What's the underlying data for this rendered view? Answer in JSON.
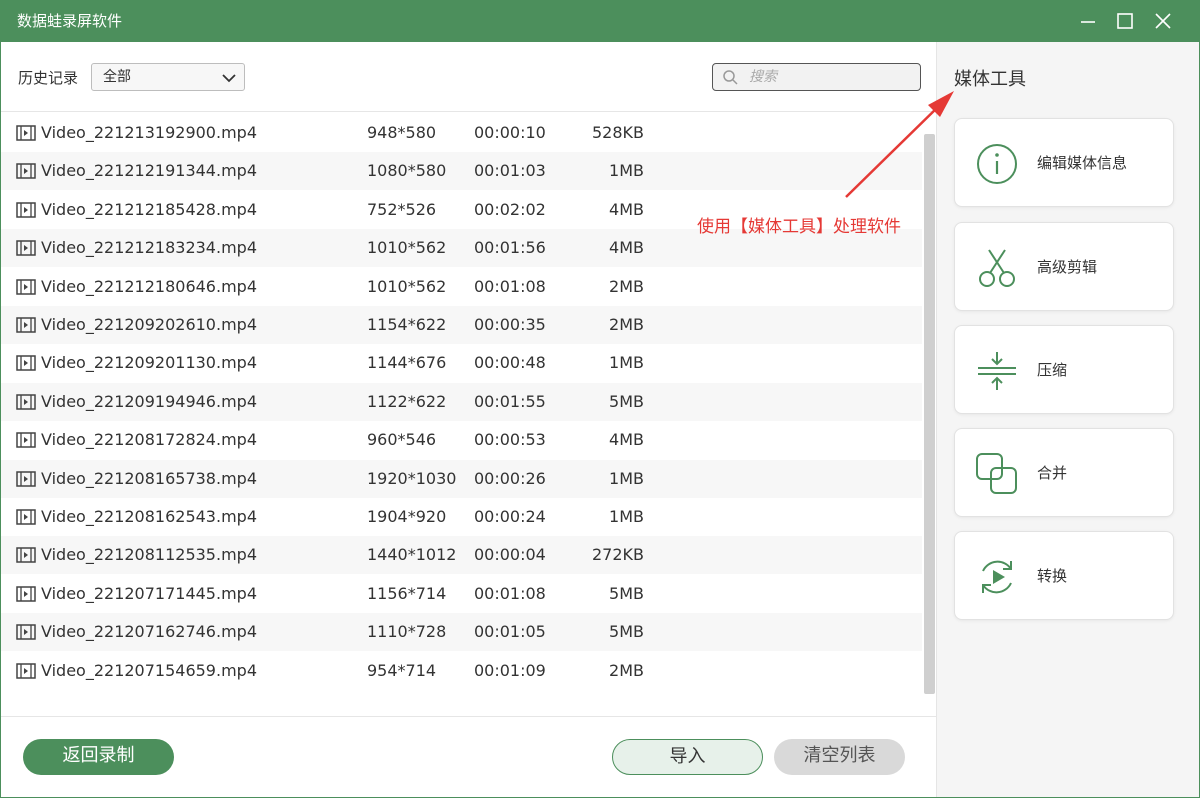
{
  "window": {
    "title": "数据蛙录屏软件"
  },
  "toolbar": {
    "history_label": "历史记录",
    "filter_value": "全部",
    "search_placeholder": "搜索"
  },
  "files": [
    {
      "name": "Video_221213192900.mp4",
      "resolution": "948*580",
      "duration": "00:00:10",
      "size": "528KB"
    },
    {
      "name": "Video_221212191344.mp4",
      "resolution": "1080*580",
      "duration": "00:01:03",
      "size": "1MB"
    },
    {
      "name": "Video_221212185428.mp4",
      "resolution": "752*526",
      "duration": "00:02:02",
      "size": "4MB"
    },
    {
      "name": "Video_221212183234.mp4",
      "resolution": "1010*562",
      "duration": "00:01:56",
      "size": "4MB"
    },
    {
      "name": "Video_221212180646.mp4",
      "resolution": "1010*562",
      "duration": "00:01:08",
      "size": "2MB"
    },
    {
      "name": "Video_221209202610.mp4",
      "resolution": "1154*622",
      "duration": "00:00:35",
      "size": "2MB"
    },
    {
      "name": "Video_221209201130.mp4",
      "resolution": "1144*676",
      "duration": "00:00:48",
      "size": "1MB"
    },
    {
      "name": "Video_221209194946.mp4",
      "resolution": "1122*622",
      "duration": "00:01:55",
      "size": "5MB"
    },
    {
      "name": "Video_221208172824.mp4",
      "resolution": "960*546",
      "duration": "00:00:53",
      "size": "4MB"
    },
    {
      "name": "Video_221208165738.mp4",
      "resolution": "1920*1030",
      "duration": "00:00:26",
      "size": "1MB"
    },
    {
      "name": "Video_221208162543.mp4",
      "resolution": "1904*920",
      "duration": "00:00:24",
      "size": "1MB"
    },
    {
      "name": "Video_221208112535.mp4",
      "resolution": "1440*1012",
      "duration": "00:00:04",
      "size": "272KB"
    },
    {
      "name": "Video_221207171445.mp4",
      "resolution": "1156*714",
      "duration": "00:01:08",
      "size": "5MB"
    },
    {
      "name": "Video_221207162746.mp4",
      "resolution": "1110*728",
      "duration": "00:01:05",
      "size": "5MB"
    },
    {
      "name": "Video_221207154659.mp4",
      "resolution": "954*714",
      "duration": "00:01:09",
      "size": "2MB"
    }
  ],
  "bottom": {
    "back_label": "返回录制",
    "import_label": "导入",
    "clear_label": "清空列表"
  },
  "tools": {
    "title": "媒体工具",
    "items": [
      {
        "label": "编辑媒体信息",
        "icon": "info-icon"
      },
      {
        "label": "高级剪辑",
        "icon": "scissors-icon"
      },
      {
        "label": "压缩",
        "icon": "compress-icon"
      },
      {
        "label": "合并",
        "icon": "merge-icon"
      },
      {
        "label": "转换",
        "icon": "convert-icon"
      }
    ]
  },
  "annotation": {
    "text": "使用【媒体工具】处理软件"
  },
  "colors": {
    "accent": "#4c8f5c",
    "annotation": "#e53935"
  }
}
